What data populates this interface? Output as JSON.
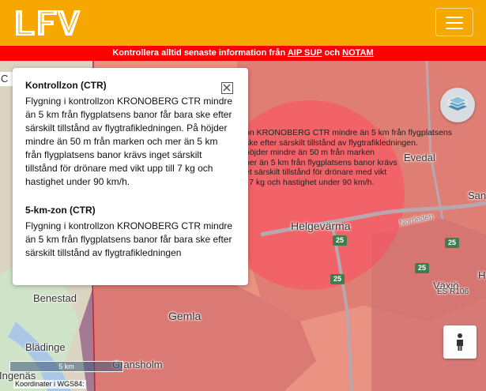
{
  "header": {
    "logo_text": "LFV",
    "logo_icon": "lfv-logo",
    "menu_icon": "hamburger-menu-icon"
  },
  "notice": {
    "prefix": "Kontrollera alltid senaste information från ",
    "link_aip": "AIP SUP",
    "middle": " och ",
    "link_notam": "NOTAM"
  },
  "map": {
    "edge_label": "C",
    "places": {
      "evedal": "Evedal",
      "sand": "San",
      "helgevarma": "Helgevärma",
      "vaxjo": "Växjö",
      "benestad": "Benestad",
      "gemla": "Gemla",
      "bladinge": "Blädinge",
      "gransholm": "Gransholm",
      "ingenas": "Ingenäs",
      "norrleden": "Norrleden",
      "h_edge": "H",
      "es_code": "ES R106"
    },
    "road_shields": [
      "25",
      "25",
      "25",
      "25"
    ],
    "overlay_text": [
      "on KRONOBERG CTR mindre än 5 km från flygplatsens",
      "ske efter särskilt tillstånd av flygtrafikledningen.",
      "höjder mindre än 50 m från marken",
      "ner än 5 km från flygplatsens banor krävs",
      "et särskilt tillstånd för drönare med vikt",
      "l 7 kg och hastighet under 90 km/h."
    ],
    "scale_label": "5 km",
    "coord_label": "Koordinater i WGS84:",
    "layers_icon": "layers-icon",
    "person_icon": "person-icon"
  },
  "popup": {
    "close_icon": "close-icon",
    "section1_title": "Kontrollzon (CTR)",
    "section1_text": "Flygning i kontrollzon KRONOBERG CTR mindre än 5 km från flygplatsens banor får bara ske efter särskilt tillstånd av flygtrafikledningen. På höjder mindre än 50 m från marken och mer än 5 km från flygplatsens banor krävs inget särskilt tillstånd för drönare med vikt upp till 7 kg och hastighet under 90 km/h.",
    "section2_title": "5-km-zon (CTR)",
    "section2_text": "Flygning i kontrollzon KRONOBERG CTR mindre än 5 km från flygplatsens banor får bara ske efter särskilt tillstånd av flygtrafikledningen"
  },
  "colors": {
    "header": "#f6a800",
    "notice": "#ff0000",
    "ctr_zone": "#f07a6a",
    "five_km_zone": "#ff4d5e",
    "urban": "#8a6a8e"
  }
}
